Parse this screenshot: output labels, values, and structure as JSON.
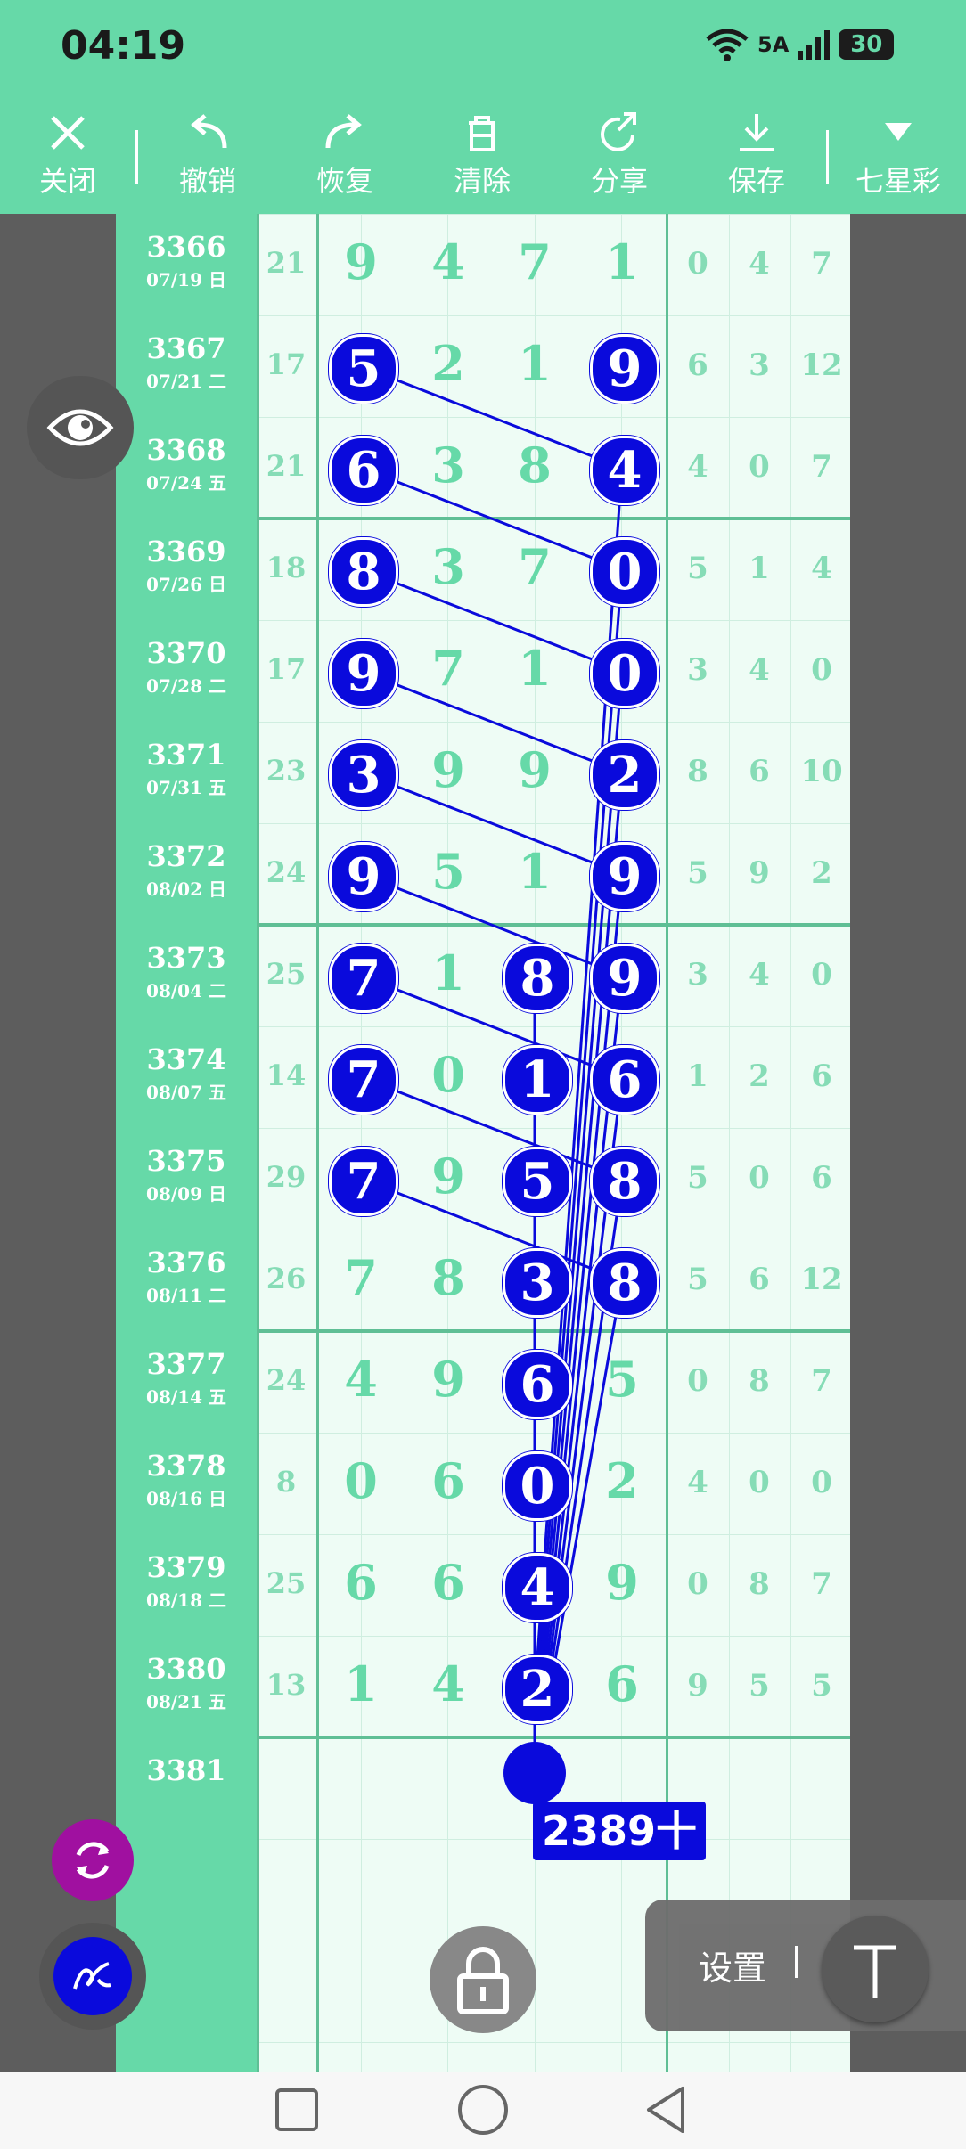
{
  "status_bar": {
    "time": "04:19",
    "network": "5A",
    "battery": "30"
  },
  "toolbar": {
    "close": "关闭",
    "undo": "撤销",
    "redo": "恢复",
    "clear": "清除",
    "share": "分享",
    "save": "保存",
    "lottery": "七星彩"
  },
  "rows": [
    {
      "id": "3366",
      "date": "07/19 日",
      "sum": "21",
      "main": [
        "9",
        "4",
        "7",
        "1"
      ],
      "tail": [
        "0",
        "4",
        "7"
      ]
    },
    {
      "id": "3367",
      "date": "07/21 二",
      "sum": "17",
      "main": [
        "5",
        "2",
        "1",
        "9"
      ],
      "tail": [
        "6",
        "3",
        "12"
      ]
    },
    {
      "id": "3368",
      "date": "07/24 五",
      "sum": "21",
      "main": [
        "6",
        "3",
        "8",
        "4"
      ],
      "tail": [
        "4",
        "0",
        "7"
      ]
    },
    {
      "id": "3369",
      "date": "07/26 日",
      "sum": "18",
      "main": [
        "8",
        "3",
        "7",
        "0"
      ],
      "tail": [
        "5",
        "1",
        "4"
      ]
    },
    {
      "id": "3370",
      "date": "07/28 二",
      "sum": "17",
      "main": [
        "9",
        "7",
        "1",
        "0"
      ],
      "tail": [
        "3",
        "4",
        "0"
      ]
    },
    {
      "id": "3371",
      "date": "07/31 五",
      "sum": "23",
      "main": [
        "3",
        "9",
        "9",
        "2"
      ],
      "tail": [
        "8",
        "6",
        "10"
      ]
    },
    {
      "id": "3372",
      "date": "08/02 日",
      "sum": "24",
      "main": [
        "9",
        "5",
        "1",
        "9"
      ],
      "tail": [
        "5",
        "9",
        "2"
      ]
    },
    {
      "id": "3373",
      "date": "08/04 二",
      "sum": "25",
      "main": [
        "7",
        "1",
        "8",
        "9"
      ],
      "tail": [
        "3",
        "4",
        "0"
      ]
    },
    {
      "id": "3374",
      "date": "08/07 五",
      "sum": "14",
      "main": [
        "7",
        "0",
        "1",
        "6"
      ],
      "tail": [
        "1",
        "2",
        "6"
      ]
    },
    {
      "id": "3375",
      "date": "08/09 日",
      "sum": "29",
      "main": [
        "7",
        "9",
        "5",
        "8"
      ],
      "tail": [
        "5",
        "0",
        "6"
      ]
    },
    {
      "id": "3376",
      "date": "08/11 二",
      "sum": "26",
      "main": [
        "7",
        "8",
        "3",
        "8"
      ],
      "tail": [
        "5",
        "6",
        "12"
      ]
    },
    {
      "id": "3377",
      "date": "08/14 五",
      "sum": "24",
      "main": [
        "4",
        "9",
        "6",
        "5"
      ],
      "tail": [
        "0",
        "8",
        "7"
      ]
    },
    {
      "id": "3378",
      "date": "08/16 日",
      "sum": "8",
      "main": [
        "0",
        "6",
        "0",
        "2"
      ],
      "tail": [
        "4",
        "0",
        "0"
      ]
    },
    {
      "id": "3379",
      "date": "08/18 二",
      "sum": "25",
      "main": [
        "6",
        "6",
        "4",
        "9"
      ],
      "tail": [
        "0",
        "8",
        "7"
      ]
    },
    {
      "id": "3380",
      "date": "08/21 五",
      "sum": "13",
      "main": [
        "1",
        "4",
        "2",
        "6"
      ],
      "tail": [
        "9",
        "5",
        "5"
      ]
    },
    {
      "id": "3381",
      "date": "",
      "sum": "",
      "main": [
        "",
        "",
        "",
        ""
      ],
      "tail": [
        "",
        "",
        ""
      ]
    }
  ],
  "highlighted": [
    {
      "row": 1,
      "col": 0
    },
    {
      "row": 1,
      "col": 3
    },
    {
      "row": 2,
      "col": 0
    },
    {
      "row": 2,
      "col": 3
    },
    {
      "row": 3,
      "col": 0
    },
    {
      "row": 3,
      "col": 3
    },
    {
      "row": 4,
      "col": 0
    },
    {
      "row": 4,
      "col": 3
    },
    {
      "row": 5,
      "col": 0
    },
    {
      "row": 5,
      "col": 3
    },
    {
      "row": 6,
      "col": 0
    },
    {
      "row": 6,
      "col": 3
    },
    {
      "row": 7,
      "col": 0
    },
    {
      "row": 7,
      "col": 2
    },
    {
      "row": 7,
      "col": 3
    },
    {
      "row": 8,
      "col": 0
    },
    {
      "row": 8,
      "col": 2
    },
    {
      "row": 8,
      "col": 3
    },
    {
      "row": 9,
      "col": 0
    },
    {
      "row": 9,
      "col": 2
    },
    {
      "row": 9,
      "col": 3
    },
    {
      "row": 10,
      "col": 2
    },
    {
      "row": 10,
      "col": 3
    },
    {
      "row": 11,
      "col": 2
    },
    {
      "row": 12,
      "col": 2
    },
    {
      "row": 13,
      "col": 2
    },
    {
      "row": 14,
      "col": 2
    }
  ],
  "prediction_label": "2389十",
  "panel": {
    "settings": "设置"
  },
  "accent_color": "#66d9a8",
  "marker_color": "#0a0adc"
}
